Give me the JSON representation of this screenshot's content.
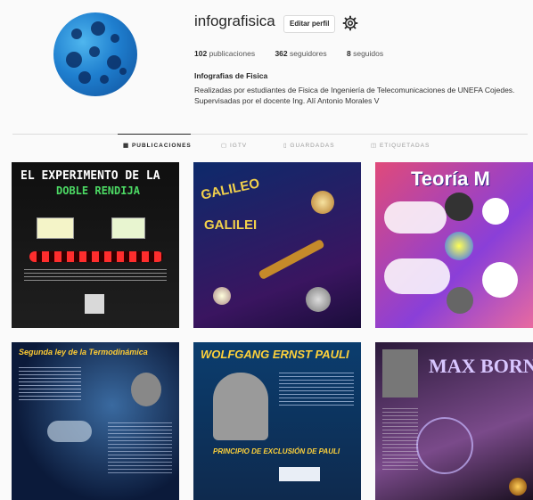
{
  "profile": {
    "username": "infografisica",
    "edit_button": "Editar perfil",
    "settings_icon": "gear-icon",
    "stats": {
      "posts": "102",
      "posts_label": "publicaciones",
      "followers": "362",
      "followers_label": "seguidores",
      "following": "8",
      "following_label": "seguidos"
    },
    "display_name": "Infografias de Fisica",
    "bio": "Realizadas por estudiantes de Fisica de Ingeniería de Telecomunicaciones de UNEFA Cojedes. Supervisadas por el docente Ing. Alí Antonio Morales V"
  },
  "tabs": [
    {
      "label": "PUBLICACIONES",
      "icon": "grid-icon"
    },
    {
      "label": "IGTV",
      "icon": "tv-icon"
    },
    {
      "label": "GUARDADAS",
      "icon": "bookmark-icon"
    },
    {
      "label": "ETIQUETADAS",
      "icon": "tag-icon"
    }
  ],
  "posts": [
    {
      "title_line1": "EL EXPERIMENTO DE LA",
      "title_line2": "DOBLE RENDIJA",
      "colors": [
        "#111",
        "#2a2a2a"
      ],
      "accent": "#4cd964"
    },
    {
      "title_line1": "GALILEO",
      "title_line2": "GALILEI",
      "colors": [
        "#0d2a6b",
        "#3a1560"
      ],
      "accent": "#f2d14b"
    },
    {
      "title_line1": "Teoría M",
      "title_line2": "",
      "colors": [
        "#e04a7a",
        "#8a3fd8"
      ],
      "accent": "#ffffff"
    },
    {
      "title_line1": "Segunda ley de la Termodinámica",
      "title_line2": "",
      "colors": [
        "#0b1a3a",
        "#2b4a7a"
      ],
      "accent": "#ffcc33"
    },
    {
      "title_line1": "WOLFGANG ERNST PAULI",
      "title_line2": "PRINCIPIO DE EXCLUSIÓN DE PAULI",
      "colors": [
        "#0b3d6e",
        "#0e2a4e"
      ],
      "accent": "#ffd23a"
    },
    {
      "title_line1": "MAX BORN",
      "title_line2": "",
      "colors": [
        "#2b1a3a",
        "#7a4a8a"
      ],
      "accent": "#d8c6ff"
    }
  ]
}
